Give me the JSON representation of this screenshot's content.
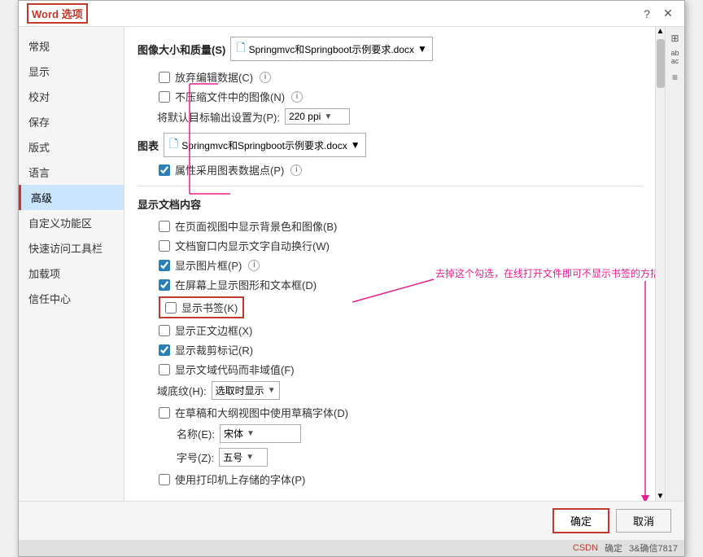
{
  "title": "Word 选项",
  "titleBox": "Word 选项",
  "sidebar": {
    "items": [
      {
        "id": "general",
        "label": "常规"
      },
      {
        "id": "display",
        "label": "显示"
      },
      {
        "id": "proofing",
        "label": "校对"
      },
      {
        "id": "save",
        "label": "保存"
      },
      {
        "id": "style",
        "label": "版式"
      },
      {
        "id": "language",
        "label": "语言"
      },
      {
        "id": "advanced",
        "label": "高级",
        "active": true
      },
      {
        "id": "customize",
        "label": "自定义功能区"
      },
      {
        "id": "quickaccess",
        "label": "快速访问工具栏"
      },
      {
        "id": "addins",
        "label": "加载项"
      },
      {
        "id": "trustcenter",
        "label": "信任中心"
      }
    ]
  },
  "main": {
    "imageSection": {
      "label": "图像大小和质量(S)",
      "fileDropdown": "Springmvc和Springboot示例要求.docx",
      "discardEditing": "放弃编辑数据(C)",
      "noCompress": "不压缩文件中的图像(N)",
      "dpiLabel": "将默认目标输出设置为(P):",
      "dpiValue": "220 ppi"
    },
    "chartSection": {
      "label": "图表",
      "fileDropdown": "Springmvc和Springboot示例要求.docx",
      "chartDataPoints": "属性采用图表数据点(P)"
    },
    "displaySection": {
      "title": "显示文档内容",
      "items": [
        {
          "id": "show-bg",
          "label": "在页面视图中显示背景色和图像(B)",
          "checked": false
        },
        {
          "id": "show-wrap",
          "label": "文档窗口内显示文字自动换行(W)",
          "checked": false
        },
        {
          "id": "show-pic-frame",
          "label": "显示图片框(P)",
          "checked": true,
          "info": true
        },
        {
          "id": "show-drawing",
          "label": "在屏幕上显示图形和文本框(D)",
          "checked": true
        },
        {
          "id": "show-bookmark",
          "label": "显示书签(K)",
          "checked": false,
          "highlighted": true
        },
        {
          "id": "show-main-text",
          "label": "显示正文边框(X)",
          "checked": false
        },
        {
          "id": "show-crop",
          "label": "显示裁剪标记(R)",
          "checked": true
        },
        {
          "id": "show-code",
          "label": "显示文域代码而非域值(F)",
          "checked": false
        },
        {
          "id": "field-shading",
          "label": "域底纹(H):",
          "checked": false,
          "hasDropdown": true,
          "dropdownValue": "选取时显示"
        }
      ],
      "draftFont": "在草稿和大纲视图中使用草稿字体(D)",
      "fontName": "名称(E):",
      "fontNameValue": "宋体",
      "fontSize": "字号(Z):",
      "fontSizeValue": "五号",
      "printFont": "使用打印机上存储的字体(P)"
    }
  },
  "annotation": {
    "text": "去掉这个勾选，在线打开文件即可不显示书签的方括号"
  },
  "footer": {
    "okLabel": "确定",
    "cancelLabel": "取消"
  },
  "watermark": {
    "csdn": "CSDN",
    "user": "确定",
    "suffix": "3&确信7817"
  },
  "icons": {
    "question": "?",
    "close": "✕",
    "scrollUp": "▲",
    "scrollDown": "▼",
    "arrowDown": "▼",
    "info": "i",
    "textIcon": "ab\nac",
    "grid": "⊞"
  }
}
